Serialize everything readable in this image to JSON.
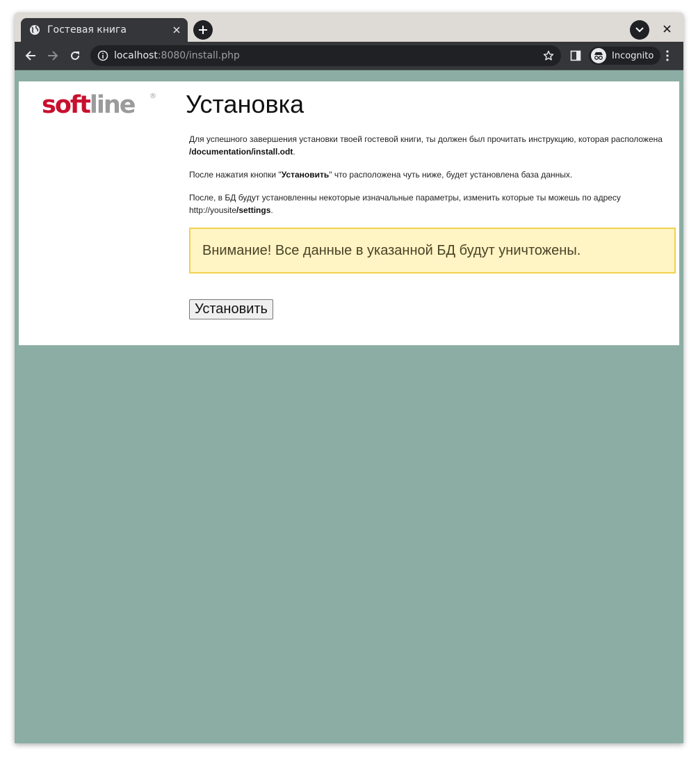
{
  "browser": {
    "tab_title": "Гостевая книга",
    "url_host": "localhost",
    "url_rest": ":8080/install.php",
    "incognito_label": "Incognito",
    "icons": {
      "favicon": "globe-icon",
      "tab_close": "close-icon",
      "new_tab": "plus-icon",
      "tab_search": "chevron-down-icon",
      "window_close": "close-icon",
      "back": "arrow-left-icon",
      "forward": "arrow-right-icon",
      "reload": "reload-icon",
      "site_info": "info-icon",
      "bookmark": "star-icon",
      "side_panel": "side-panel-icon",
      "incognito": "incognito-icon",
      "menu": "kebab-menu-icon"
    },
    "colors": {
      "tab_strip": "#dedad6",
      "toolbar": "#35363a",
      "omnibox": "#202124"
    }
  },
  "page": {
    "logo": {
      "part_red": "soft",
      "part_grey": "line",
      "registered": "®"
    },
    "title": "Установка",
    "p1_text": "Для успешного завершения установки твоей гостевой книги, ты должен был прочитать инструкцию, которая расположена ",
    "p1_path": "/documentation/install.odt",
    "p1_end": ".",
    "p2_start": "После нажатия кнопки \"",
    "p2_bold": "Установить",
    "p2_end": "\" что расположена чуть ниже, будет установлена база данных.",
    "p3_text": "После, в БД будут установленны некоторые изначальные параметры, изменить которые ты можешь по адресу http://yousite",
    "p3_bold": "/settings",
    "p3_end": ".",
    "alert_text": "Внимание! Все данные в указанной БД будут уничтожены.",
    "install_button": "Установить",
    "colors": {
      "background": "#8cada3",
      "logo_red": "#c8102e",
      "logo_grey": "#9b9b9b",
      "alert_bg": "#fff4c4",
      "alert_border": "#f2d24f"
    }
  }
}
